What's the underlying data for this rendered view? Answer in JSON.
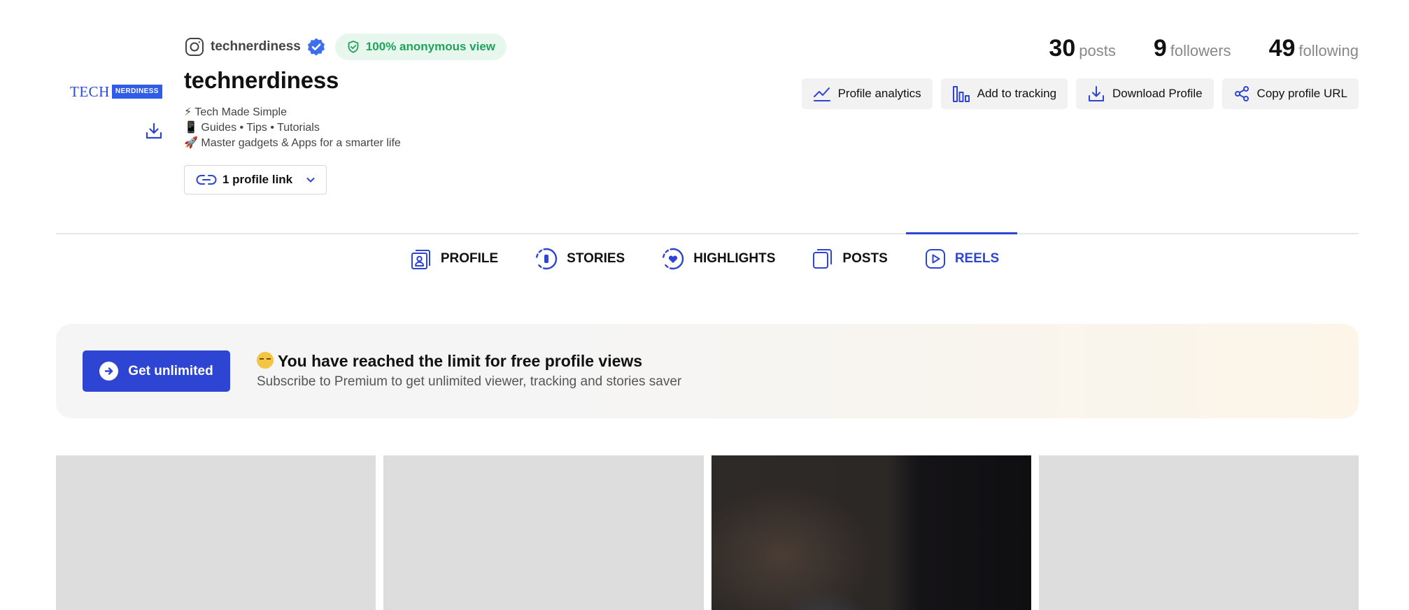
{
  "profile": {
    "avatar_text_left": "TECH",
    "avatar_text_right": "NERDINESS",
    "username": "technerdiness",
    "anonymous_badge": "100% anonymous view",
    "full_name": "technerdiness",
    "bio": [
      "⚡ Tech Made Simple",
      "📱 Guides • Tips • Tutorials",
      "🚀 Master gadgets & Apps for a smarter life"
    ],
    "profile_link_label": "1 profile link"
  },
  "stats": {
    "posts_count": "30",
    "posts_label": "posts",
    "followers_count": "9",
    "followers_label": "followers",
    "following_count": "49",
    "following_label": "following"
  },
  "actions": {
    "analytics": "Profile analytics",
    "tracking": "Add to tracking",
    "download": "Download Profile",
    "copy_url": "Copy profile URL"
  },
  "tabs": {
    "profile": "PROFILE",
    "stories": "STORIES",
    "highlights": "HIGHLIGHTS",
    "posts": "POSTS",
    "reels": "REELS",
    "active": "REELS"
  },
  "banner": {
    "button": "Get unlimited",
    "title": "You have reached the limit for free profile views",
    "subtitle": "Subscribe to Premium to get unlimited viewer, tracking and stories saver"
  },
  "colors": {
    "accent": "#2e45d4",
    "verified": "#3b6ff0",
    "anon_text": "#20a25d",
    "anon_bg": "#e7f7ee"
  },
  "icons": {
    "userline": "instagram-icon",
    "verified": "verified-badge-icon",
    "anon": "shield-check-icon",
    "link": "link-icon",
    "dropdown": "chevron-down-icon",
    "analytics": "trend-line-icon",
    "tracking": "bar-chart-icon",
    "download": "download-icon",
    "copy_url": "share-icon",
    "get_unlimited": "arrow-right-circle-icon"
  }
}
